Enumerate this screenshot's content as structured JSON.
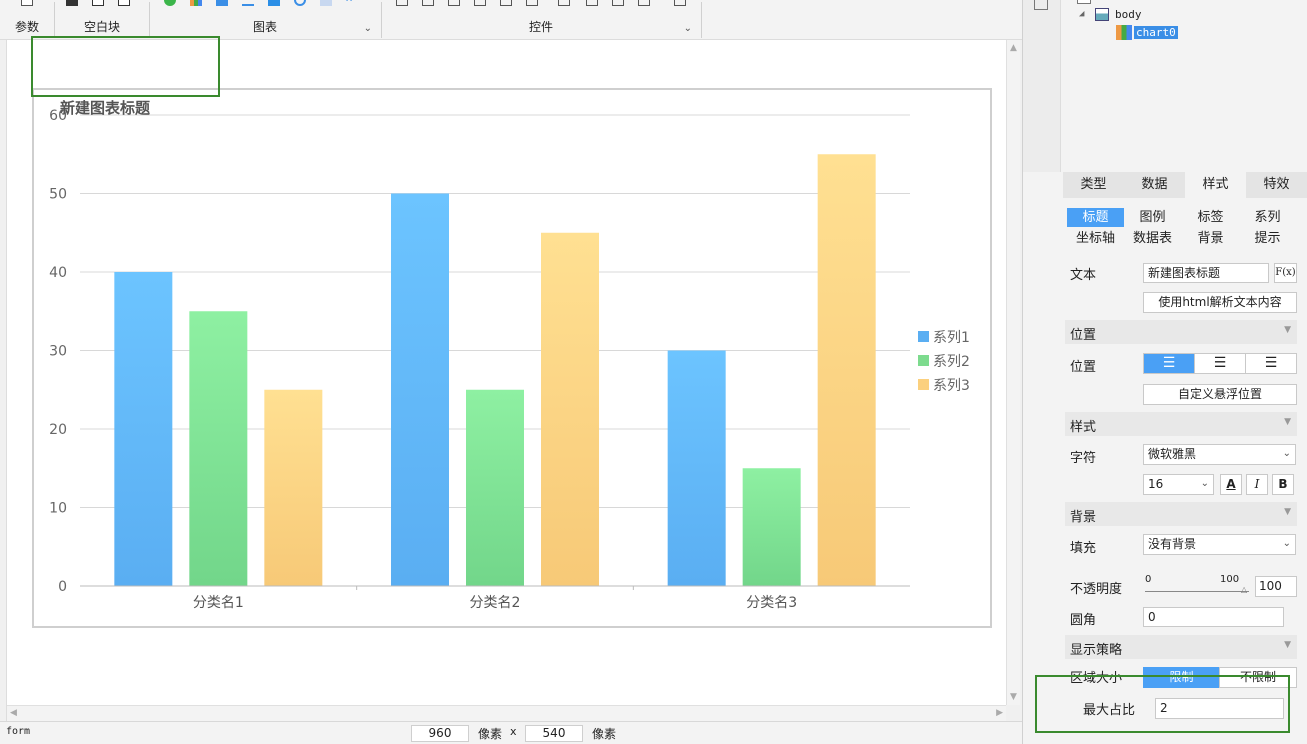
{
  "toolbar": {
    "params_label": "参数",
    "blank_label": "空白块",
    "chart_label": "图表",
    "controls_label": "控件"
  },
  "chart_data": {
    "type": "bar",
    "title": "新建图表标题",
    "categories": [
      "分类名1",
      "分类名2",
      "分类名3"
    ],
    "series": [
      {
        "name": "系列1",
        "values": [
          40,
          50,
          30
        ],
        "color": "#5aaef2"
      },
      {
        "name": "系列2",
        "values": [
          35,
          25,
          15
        ],
        "color": "#7ddb8e"
      },
      {
        "name": "系列3",
        "values": [
          25,
          45,
          55
        ],
        "color": "#fbd07e"
      }
    ],
    "ylim": [
      0,
      60
    ],
    "yticks": [
      "0",
      "10",
      "20",
      "30",
      "40",
      "50",
      "60"
    ],
    "grid": true,
    "legend": "right"
  },
  "status": {
    "form_label": "form",
    "width_value": "960",
    "px_unit_1": "像素",
    "times": "x",
    "height_value": "540",
    "px_unit_2": "像素"
  },
  "tree": {
    "body_label": "body",
    "chart_label": "chart0"
  },
  "panel": {
    "tabs": [
      "类型",
      "数据",
      "样式",
      "特效"
    ],
    "subtabs_row1": [
      "标题",
      "图例",
      "标签",
      "系列"
    ],
    "subtabs_row2": [
      "坐标轴",
      "数据表",
      "背景",
      "提示"
    ],
    "text_label": "文本",
    "text_value": "新建图表标题",
    "fx_label": "F(x)",
    "html_parse_button": "使用html解析文本内容",
    "position_section": "位置",
    "position_label": "位置",
    "custom_float_button": "自定义悬浮位置",
    "style_section": "样式",
    "font_label": "字符",
    "font_value": "微软雅黑",
    "font_size_value": "16",
    "bold_glyph": "B",
    "italic_glyph": "I",
    "color_glyph": "A",
    "background_section": "背景",
    "fill_label": "填充",
    "fill_value": "没有背景",
    "opacity_label": "不透明度",
    "opacity_min": "0",
    "opacity_max": "100",
    "opacity_value": "100",
    "radius_label": "圆角",
    "radius_value": "0",
    "display_section": "显示策略",
    "area_size_label": "区域大小",
    "limit_button": "限制",
    "unlimit_button": "不限制",
    "max_ratio_label": "最大占比",
    "max_ratio_value": "2"
  },
  "colors": {
    "accent": "#4aa0f5",
    "highlight_box": "#3a8a2e"
  }
}
